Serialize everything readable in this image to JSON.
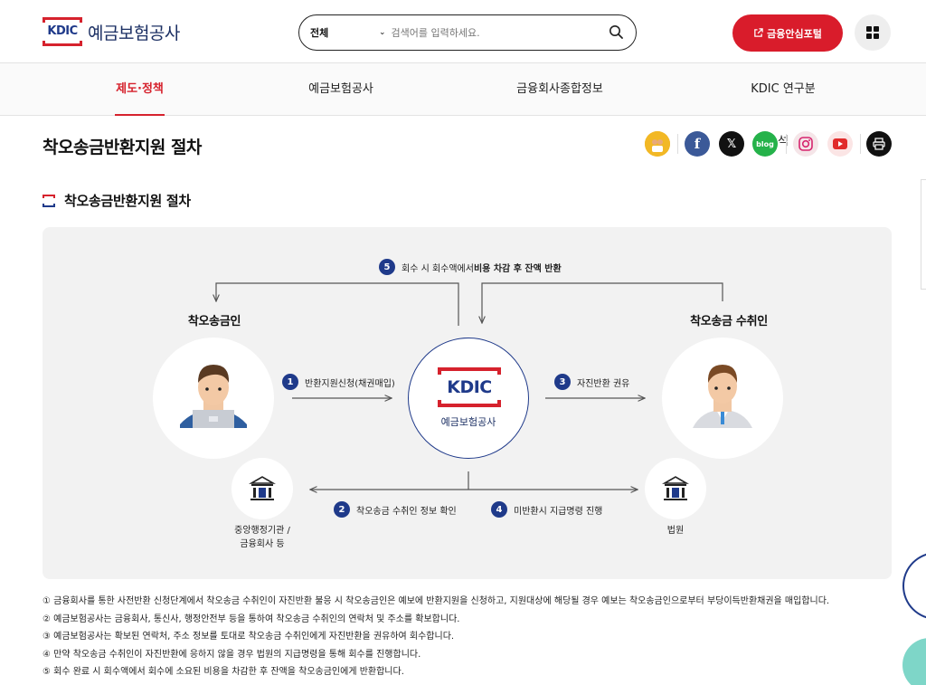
{
  "header": {
    "logo_mark": "KDIC",
    "logo_name": "예금보험공사",
    "search": {
      "category": "전체",
      "placeholder": "검색어를 입력하세요."
    },
    "portal_button": "금융안심포털",
    "menu_icon": "grid-icon"
  },
  "nav": {
    "items": [
      {
        "label": "제도·정책",
        "active": true
      },
      {
        "label": "예금보험공사",
        "active": false
      },
      {
        "label": "금융회사종합정보",
        "active": false
      },
      {
        "label": "KDIC 연구분석",
        "active": false
      }
    ]
  },
  "page": {
    "title": "착오송금반환지원 절차",
    "section_title": "착오송금반환지원 절차"
  },
  "share": {
    "icons": [
      "kakao-story-icon",
      "facebook-icon",
      "x-icon",
      "blog-icon",
      "instagram-icon",
      "youtube-icon",
      "print-icon"
    ],
    "blog_label": "blog",
    "facebook_label": "f",
    "x_label": "𝕏"
  },
  "diagram": {
    "sender_label": "착오송금인",
    "receiver_label": "착오송금 수취인",
    "center_logo": "KDIC",
    "center_name": "예금보험공사",
    "agency_label_1": "중앙행정기관 /",
    "agency_label_2": "금융회사 등",
    "court_label": "법원",
    "step1": {
      "num": "1",
      "text": "반환지원신청(채권매입)"
    },
    "step2": {
      "num": "2",
      "text": "착오송금 수취인 정보 확인"
    },
    "step3": {
      "num": "3",
      "text": "자진반환 권유"
    },
    "step4": {
      "num": "4",
      "text": "미반환시 지급명령 진행"
    },
    "step5": {
      "num": "5",
      "text_plain": "회수 시 회수액에서 ",
      "text_bold": "비용 차감 후 잔액 반환"
    }
  },
  "notes": [
    "① 금융회사를 통한 사전반환 신청단계에서 착오송금 수취인이 자진반환 불응 시 착오송금인은 예보에 반환지원을 신청하고, 지원대상에 해당될 경우 예보는 착오송금인으로부터 부당이득반환채권을 매입합니다.",
    "② 예금보험공사는 금융회사, 통신사, 행정안전부 등을 통하여 착오송금 수취인의 연락처 및 주소를 확보합니다.",
    "③ 예금보험공사는 확보된 연락처, 주소 정보를 토대로 착오송금 수취인에게 자진반환을 권유하여 회수합니다.",
    "④ 만약 착오송금 수취인이 자진반환에 응하지 않을 경우 법원의 지급명령을 통해 회수를 진행합니다.",
    "⑤ 회수 완료 시 회수액에서 회수에 소요된 비용을 차감한 후 잔액을 착오송금인에게 반환합니다."
  ],
  "colors": {
    "brand_red": "#d91c2b",
    "brand_navy": "#1f3a8a"
  }
}
